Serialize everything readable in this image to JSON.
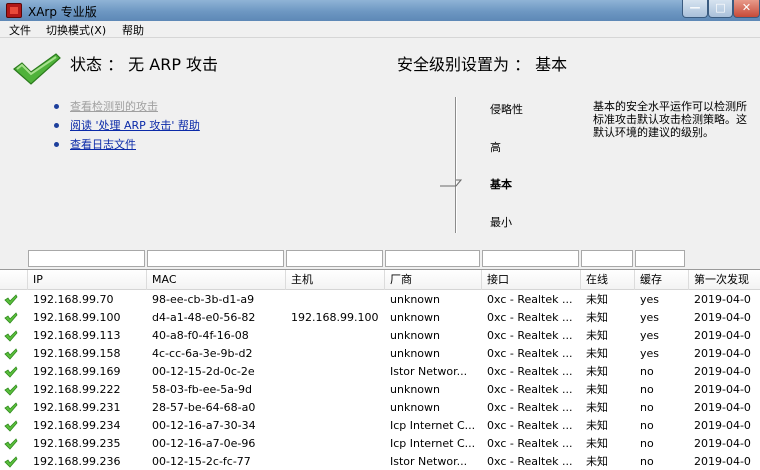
{
  "window": {
    "title": "XArp 专业版",
    "controls": [
      "minimize",
      "maximize",
      "close"
    ]
  },
  "menu": [
    "文件",
    "切换模式(X)",
    "帮助"
  ],
  "status": {
    "label": "状态 ：  无 ARP 攻击",
    "icon": "checkmark-icon",
    "color": "#3aa12b"
  },
  "security": {
    "label": "安全级别设置为 ：  基本",
    "levels": [
      "侵略性",
      "高",
      "基本",
      "最小"
    ],
    "selected": "基本",
    "description": [
      "基本的安全水平运作可以检测所",
      "标准攻击默认攻击检测策略。这",
      "默认环境的建议的级别。"
    ]
  },
  "links": [
    {
      "text": "查看检测到的攻击",
      "enabled": false
    },
    {
      "text": "阅读 '处理 ARP 攻击' 帮助",
      "enabled": true
    },
    {
      "text": "查看日志文件",
      "enabled": true
    }
  ],
  "table": {
    "columns": [
      "IP",
      "MAC",
      "主机",
      "厂商",
      "接口",
      "在线",
      "缓存",
      "第一次发现"
    ],
    "rows": [
      [
        "192.168.99.70",
        "98-ee-cb-3b-d1-a9",
        "",
        "unknown",
        "0xc - Realtek ...",
        "未知",
        "yes",
        "2019-04-0"
      ],
      [
        "192.168.99.100",
        "d4-a1-48-e0-56-82",
        "192.168.99.100",
        "unknown",
        "0xc - Realtek ...",
        "未知",
        "yes",
        "2019-04-0"
      ],
      [
        "192.168.99.113",
        "40-a8-f0-4f-16-08",
        "",
        "unknown",
        "0xc - Realtek ...",
        "未知",
        "yes",
        "2019-04-0"
      ],
      [
        "192.168.99.158",
        "4c-cc-6a-3e-9b-d2",
        "",
        "unknown",
        "0xc - Realtek ...",
        "未知",
        "yes",
        "2019-04-0"
      ],
      [
        "192.168.99.169",
        "00-12-15-2d-0c-2e",
        "",
        "Istor Networ...",
        "0xc - Realtek ...",
        "未知",
        "no",
        "2019-04-0"
      ],
      [
        "192.168.99.222",
        "58-03-fb-ee-5a-9d",
        "",
        "unknown",
        "0xc - Realtek ...",
        "未知",
        "no",
        "2019-04-0"
      ],
      [
        "192.168.99.231",
        "28-57-be-64-68-a0",
        "",
        "unknown",
        "0xc - Realtek ...",
        "未知",
        "no",
        "2019-04-0"
      ],
      [
        "192.168.99.234",
        "00-12-16-a7-30-34",
        "",
        "Icp Internet C...",
        "0xc - Realtek ...",
        "未知",
        "no",
        "2019-04-0"
      ],
      [
        "192.168.99.235",
        "00-12-16-a7-0e-96",
        "",
        "Icp Internet C...",
        "0xc - Realtek ...",
        "未知",
        "no",
        "2019-04-0"
      ],
      [
        "192.168.99.236",
        "00-12-15-2c-fc-77",
        "",
        "Istor Networ...",
        "0xc - Realtek ...",
        "未知",
        "no",
        "2019-04-0"
      ]
    ]
  }
}
